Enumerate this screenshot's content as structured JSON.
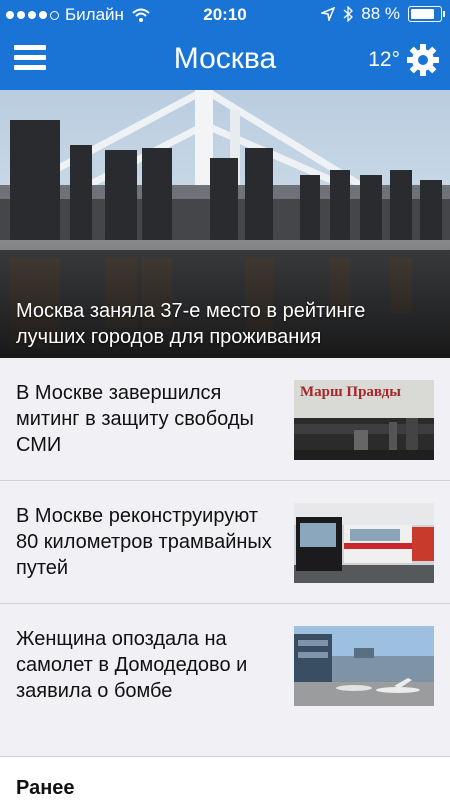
{
  "status_bar": {
    "carrier": "Билайн",
    "time": "20:10",
    "battery": "88 %",
    "battery_level": 0.88
  },
  "header": {
    "title": "Москва",
    "temperature": "12°",
    "menu_icon": "hamburger-menu-icon",
    "settings_icon": "gear-icon"
  },
  "hero": {
    "title": "Москва заняла 37-е место в рейтинге лучших городов для проживания"
  },
  "news": [
    {
      "title": "В Москве завершился митинг в защиту свободы СМИ",
      "thumb_text": "Марш Правды"
    },
    {
      "title": "В Москве реконструируют 80 километров трамвайных путей"
    },
    {
      "title": "Женщина опоздала на самолет в Домодедово и заявила о бомбе"
    }
  ],
  "sections": {
    "earlier": "Ранее"
  },
  "colors": {
    "accent": "#1a74d6",
    "list_background": "#f0f0f5"
  }
}
